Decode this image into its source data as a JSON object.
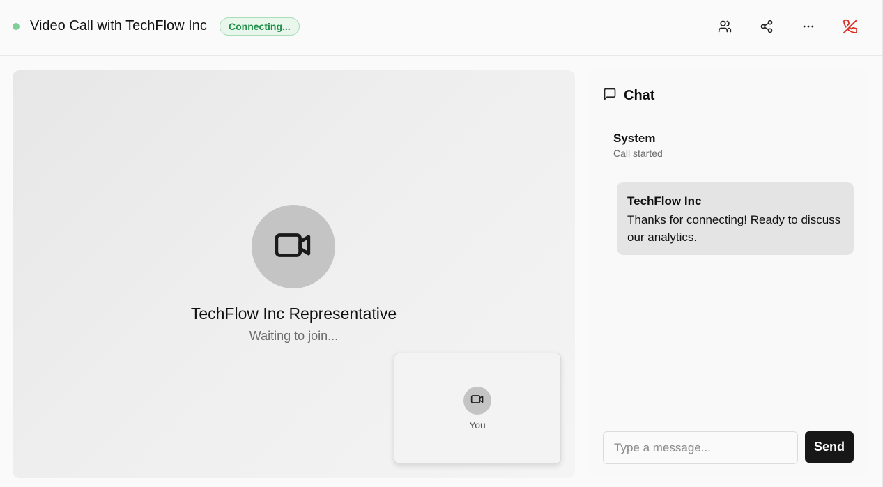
{
  "header": {
    "title": "Video Call with TechFlow Inc",
    "status": "Connecting...",
    "status_color": "#1f8f47",
    "indicator_color": "#7fcf99",
    "actions": [
      {
        "icon": "participants-icon"
      },
      {
        "icon": "share-icon"
      },
      {
        "icon": "more-icon"
      },
      {
        "icon": "end-call-icon",
        "color": "#d93025"
      }
    ]
  },
  "video": {
    "remote_name": "TechFlow Inc Representative",
    "remote_status": "Waiting to join...",
    "remote_icon": "video-camera-icon",
    "self_label": "You",
    "self_icon": "video-camera-icon"
  },
  "chat": {
    "title": "Chat",
    "icon": "message-square-icon",
    "messages": [
      {
        "sender": "System",
        "text": "Call started"
      },
      {
        "sender": "TechFlow Inc",
        "text": "Thanks for connecting! Ready to discuss our analytics."
      }
    ],
    "input_placeholder": "Type a message...",
    "input_value": "",
    "send_label": "Send"
  }
}
